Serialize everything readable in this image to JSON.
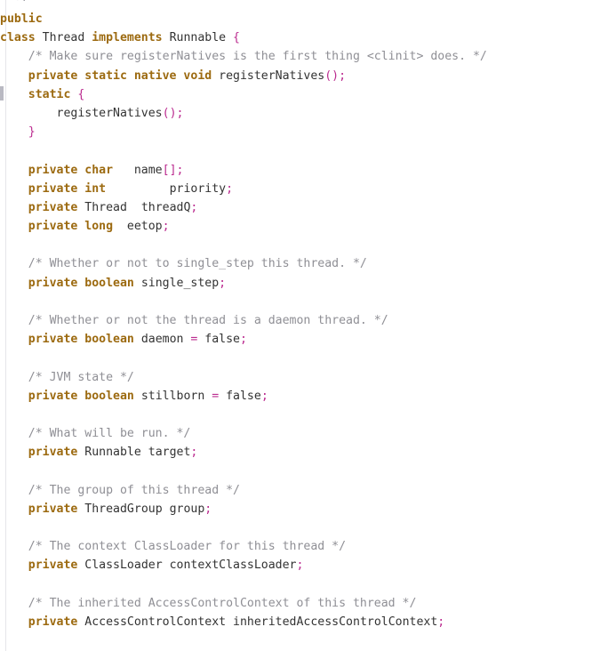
{
  "editor": {
    "language": "java",
    "background_color": "#ffffff",
    "colors": {
      "keyword": "#9c6a10",
      "comment": "#8f8f95",
      "punctuation": "#bb2b8f",
      "identifier": "#333333",
      "gutter_rule": "#e6e6ea",
      "gutter_marker": "#b9b9c2"
    }
  },
  "gutter": {
    "marker_label": "change-marker"
  },
  "code": {
    "lines": [
      {
        "id": "line-1",
        "indent": 2,
        "tokens": [
          {
            "t": "*/",
            "c": "cmt"
          }
        ]
      },
      {
        "id": "line-2",
        "indent": 0,
        "tokens": [
          {
            "t": "public",
            "c": "kw"
          }
        ]
      },
      {
        "id": "line-3",
        "indent": 0,
        "tokens": [
          {
            "t": "class ",
            "c": "kw"
          },
          {
            "t": "Thread ",
            "c": "typ"
          },
          {
            "t": "implements ",
            "c": "kw"
          },
          {
            "t": "Runnable ",
            "c": "typ"
          },
          {
            "t": "{",
            "c": "pun"
          }
        ]
      },
      {
        "id": "line-4",
        "indent": 4,
        "tokens": [
          {
            "t": "/* Make sure registerNatives is the first thing <clinit> does. */",
            "c": "cmt"
          }
        ]
      },
      {
        "id": "line-5",
        "indent": 4,
        "tokens": [
          {
            "t": "private static native void ",
            "c": "kw"
          },
          {
            "t": "registerNatives",
            "c": "id"
          },
          {
            "t": "();",
            "c": "pun"
          }
        ]
      },
      {
        "id": "line-6",
        "indent": 4,
        "tokens": [
          {
            "t": "static ",
            "c": "kw"
          },
          {
            "t": "{",
            "c": "pun"
          }
        ]
      },
      {
        "id": "line-7",
        "indent": 8,
        "tokens": [
          {
            "t": "registerNatives",
            "c": "id"
          },
          {
            "t": "();",
            "c": "pun"
          }
        ]
      },
      {
        "id": "line-8",
        "indent": 4,
        "tokens": [
          {
            "t": "}",
            "c": "pun"
          }
        ]
      },
      {
        "id": "line-9",
        "indent": 0,
        "tokens": []
      },
      {
        "id": "line-10",
        "indent": 4,
        "tokens": [
          {
            "t": "private char",
            "c": "kw"
          },
          {
            "t": "   name",
            "c": "id"
          },
          {
            "t": "[];",
            "c": "pun"
          }
        ]
      },
      {
        "id": "line-11",
        "indent": 4,
        "tokens": [
          {
            "t": "private int",
            "c": "kw"
          },
          {
            "t": "         priority",
            "c": "id"
          },
          {
            "t": ";",
            "c": "pun"
          }
        ]
      },
      {
        "id": "line-12",
        "indent": 4,
        "tokens": [
          {
            "t": "private ",
            "c": "kw"
          },
          {
            "t": "Thread  threadQ",
            "c": "typ"
          },
          {
            "t": ";",
            "c": "pun"
          }
        ]
      },
      {
        "id": "line-13",
        "indent": 4,
        "tokens": [
          {
            "t": "private long",
            "c": "kw"
          },
          {
            "t": "  eetop",
            "c": "id"
          },
          {
            "t": ";",
            "c": "pun"
          }
        ]
      },
      {
        "id": "line-14",
        "indent": 0,
        "tokens": []
      },
      {
        "id": "line-15",
        "indent": 4,
        "tokens": [
          {
            "t": "/* Whether or not to single_step this thread. */",
            "c": "cmt"
          }
        ]
      },
      {
        "id": "line-16",
        "indent": 4,
        "tokens": [
          {
            "t": "private boolean ",
            "c": "kw"
          },
          {
            "t": "single_step",
            "c": "id"
          },
          {
            "t": ";",
            "c": "pun"
          }
        ]
      },
      {
        "id": "line-17",
        "indent": 0,
        "tokens": []
      },
      {
        "id": "line-18",
        "indent": 4,
        "tokens": [
          {
            "t": "/* Whether or not the thread is a daemon thread. */",
            "c": "cmt"
          }
        ]
      },
      {
        "id": "line-19",
        "indent": 4,
        "tokens": [
          {
            "t": "private boolean ",
            "c": "kw"
          },
          {
            "t": "daemon ",
            "c": "id"
          },
          {
            "t": "= ",
            "c": "pun"
          },
          {
            "t": "false",
            "c": "id"
          },
          {
            "t": ";",
            "c": "pun"
          }
        ]
      },
      {
        "id": "line-20",
        "indent": 0,
        "tokens": []
      },
      {
        "id": "line-21",
        "indent": 4,
        "tokens": [
          {
            "t": "/* JVM state */",
            "c": "cmt"
          }
        ]
      },
      {
        "id": "line-22",
        "indent": 4,
        "tokens": [
          {
            "t": "private boolean ",
            "c": "kw"
          },
          {
            "t": "stillborn ",
            "c": "id"
          },
          {
            "t": "= ",
            "c": "pun"
          },
          {
            "t": "false",
            "c": "id"
          },
          {
            "t": ";",
            "c": "pun"
          }
        ]
      },
      {
        "id": "line-23",
        "indent": 0,
        "tokens": []
      },
      {
        "id": "line-24",
        "indent": 4,
        "tokens": [
          {
            "t": "/* What will be run. */",
            "c": "cmt"
          }
        ]
      },
      {
        "id": "line-25",
        "indent": 4,
        "tokens": [
          {
            "t": "private ",
            "c": "kw"
          },
          {
            "t": "Runnable target",
            "c": "typ"
          },
          {
            "t": ";",
            "c": "pun"
          }
        ]
      },
      {
        "id": "line-26",
        "indent": 0,
        "tokens": []
      },
      {
        "id": "line-27",
        "indent": 4,
        "tokens": [
          {
            "t": "/* The group of this thread */",
            "c": "cmt"
          }
        ]
      },
      {
        "id": "line-28",
        "indent": 4,
        "tokens": [
          {
            "t": "private ",
            "c": "kw"
          },
          {
            "t": "ThreadGroup group",
            "c": "typ"
          },
          {
            "t": ";",
            "c": "pun"
          }
        ]
      },
      {
        "id": "line-29",
        "indent": 0,
        "tokens": []
      },
      {
        "id": "line-30",
        "indent": 4,
        "tokens": [
          {
            "t": "/* The context ClassLoader for this thread */",
            "c": "cmt"
          }
        ]
      },
      {
        "id": "line-31",
        "indent": 4,
        "tokens": [
          {
            "t": "private ",
            "c": "kw"
          },
          {
            "t": "ClassLoader contextClassLoader",
            "c": "typ"
          },
          {
            "t": ";",
            "c": "pun"
          }
        ]
      },
      {
        "id": "line-32",
        "indent": 0,
        "tokens": []
      },
      {
        "id": "line-33",
        "indent": 4,
        "tokens": [
          {
            "t": "/* The inherited AccessControlContext of this thread */",
            "c": "cmt"
          }
        ]
      },
      {
        "id": "line-34",
        "indent": 4,
        "tokens": [
          {
            "t": "private ",
            "c": "kw"
          },
          {
            "t": "AccessControlContext inheritedAccessControlContext",
            "c": "typ"
          },
          {
            "t": ";",
            "c": "pun"
          }
        ]
      }
    ]
  }
}
